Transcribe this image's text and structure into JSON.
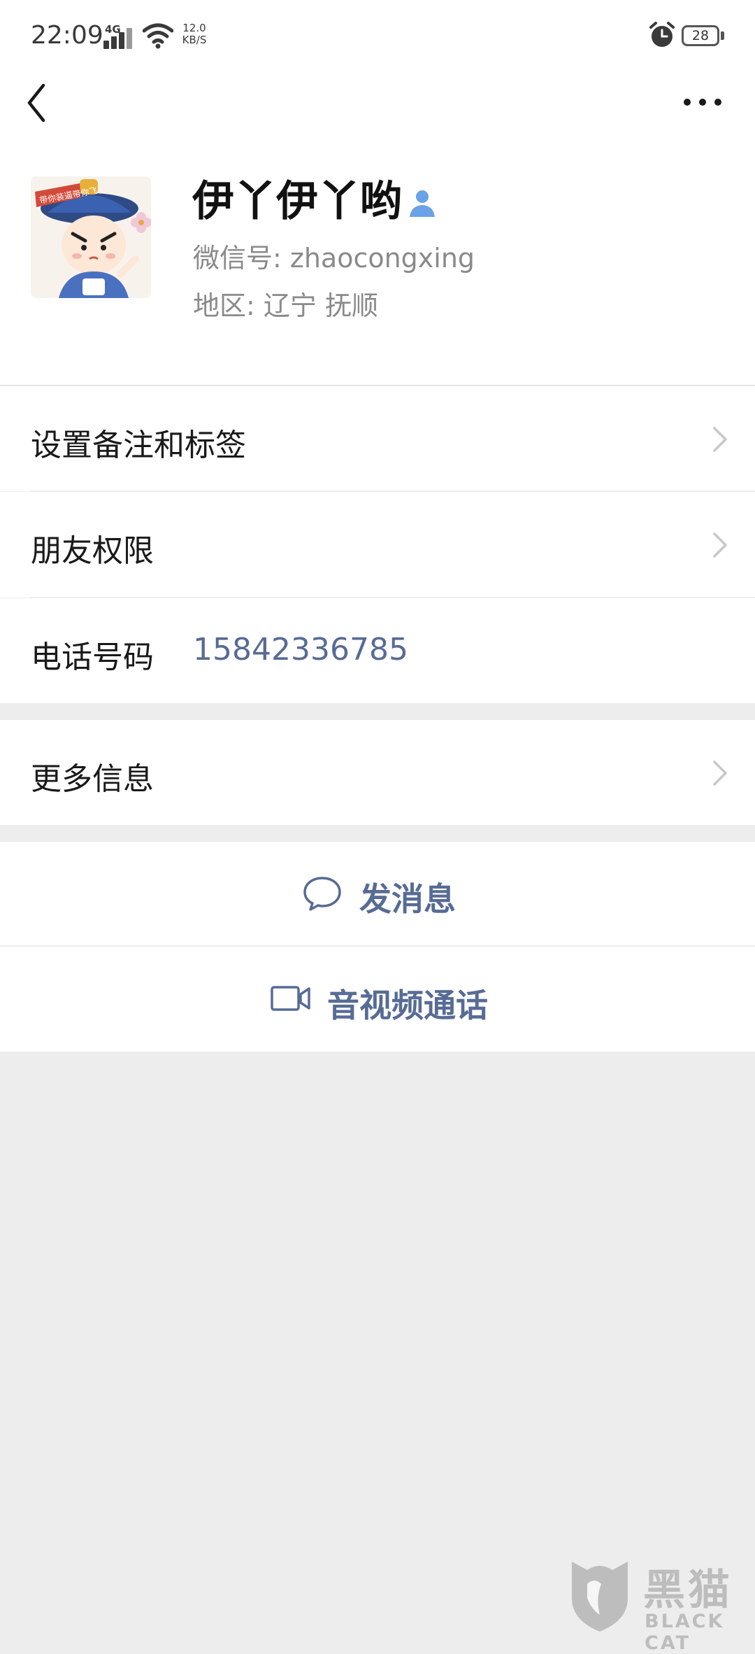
{
  "status_bar": {
    "time": "22:09",
    "network": "4G",
    "speed_value": "12.0",
    "speed_unit": "KB/S",
    "battery": "28",
    "icons": [
      "signal-icon",
      "wifi-icon",
      "alarm-icon",
      "battery-icon"
    ]
  },
  "nav": {
    "back_icon": "chevron-left-icon",
    "more_icon": "more-horizontal-icon"
  },
  "profile": {
    "name": "伊丫伊丫哟",
    "wechat_id": "微信号: zhaocongxing",
    "region": "地区: 辽宁  抚顺",
    "avatar_icon": "cartoon-avatar",
    "contact_icon": "person-icon",
    "avatar_caption": "带你装逼带你飞"
  },
  "cells": {
    "remark": "设置备注和标签",
    "permissions": "朋友权限",
    "phone_label": "电话号码",
    "phone_value": "15842336785",
    "more_info": "更多信息"
  },
  "actions": {
    "message": "发消息",
    "call": "音视频通话"
  },
  "watermark": {
    "title": "黑猫",
    "subtitle": "BLACK CAT"
  },
  "colors": {
    "link_blue": "#576b95",
    "background_gray": "#ededed",
    "primary_text": "#191919",
    "secondary_text": "#8a8a8a"
  }
}
